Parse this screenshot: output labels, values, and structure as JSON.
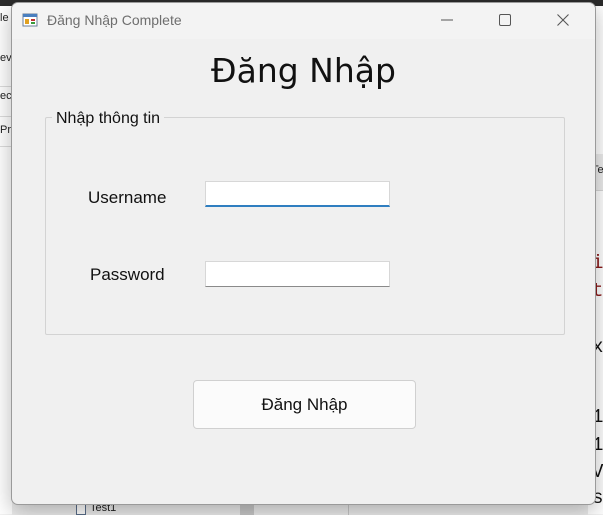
{
  "background": {
    "left_fragments": [
      "le",
      "ev",
      "ec",
      "Pr"
    ],
    "right_code": [
      {
        "text": "i",
        "kw": true
      },
      {
        "text": "t",
        "kw": true
      },
      {
        "text": "x",
        "kw": false
      },
      {
        "text": "1",
        "kw": false
      },
      {
        "text": "1",
        "kw": false
      },
      {
        "text": "V",
        "kw": false
      },
      {
        "text": "s",
        "kw": false
      }
    ],
    "right_tab_fragment": "Te",
    "tree_item": "Test1"
  },
  "window": {
    "title": "Đăng Nhập Complete",
    "minimize_symbol": "—",
    "maximize_symbol": "☐",
    "close_symbol": "✕"
  },
  "form": {
    "heading": "Đăng Nhập",
    "group_title": "Nhập thông tin",
    "username_label": "Username",
    "username_value": "",
    "password_label": "Password",
    "password_value": "",
    "submit_label": "Đăng Nhập"
  },
  "colors": {
    "accent": "#2f7ec0",
    "window_bg": "#f0f0f0"
  }
}
